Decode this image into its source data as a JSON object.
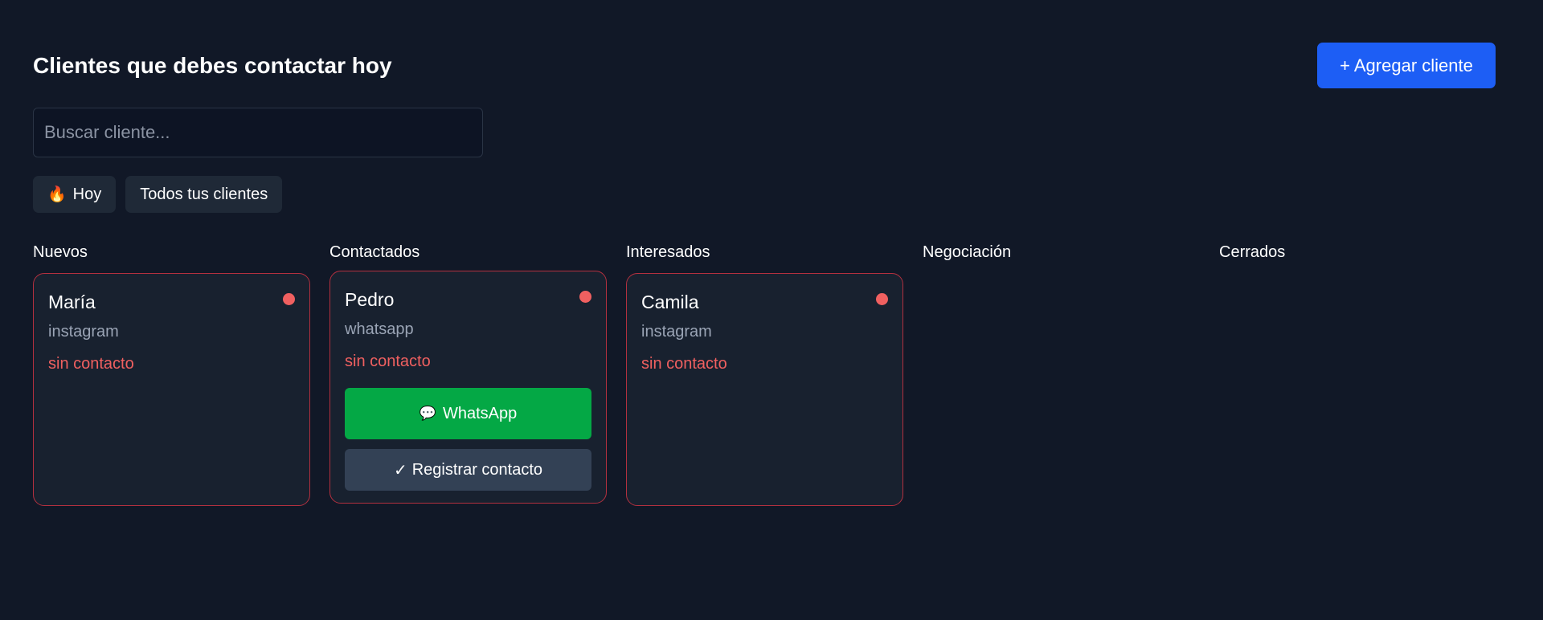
{
  "header": {
    "title": "Clientes que debes contactar hoy",
    "add_button_label": "+ Agregar cliente"
  },
  "search": {
    "placeholder": "Buscar cliente...",
    "value": ""
  },
  "filters": [
    {
      "icon": "flame-icon",
      "glyph": "🔥",
      "label": "Hoy"
    },
    {
      "label": "Todos tus clientes"
    }
  ],
  "columns": [
    {
      "title": "Nuevos"
    },
    {
      "title": "Contactados"
    },
    {
      "title": "Interesados"
    },
    {
      "title": "Negociación"
    },
    {
      "title": "Cerrados"
    }
  ],
  "cards": {
    "maria": {
      "name": "María",
      "source": "instagram",
      "status": "sin contacto"
    },
    "pedro": {
      "name": "Pedro",
      "source": "whatsapp",
      "status": "sin contacto",
      "whatsapp_label": "WhatsApp",
      "whatsapp_icon": "💬",
      "register_label": "Registrar contacto",
      "register_icon": "✓"
    },
    "camila": {
      "name": "Camila",
      "source": "instagram",
      "status": "sin contacto"
    }
  },
  "colors": {
    "background": "#111827",
    "card": "#18212f",
    "accent_blue": "#1d5ef5",
    "whatsapp_green": "#04a845",
    "alert_red": "#f06060"
  }
}
